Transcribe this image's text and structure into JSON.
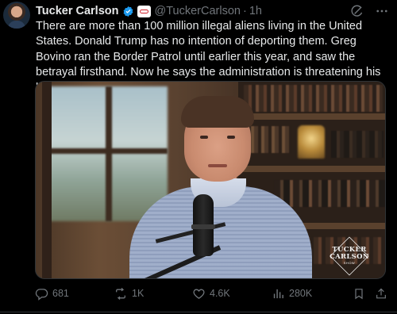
{
  "author": {
    "name": "Tucker Carlson",
    "handle": "@TuckerCarlson",
    "separator": "·",
    "time": "1h"
  },
  "tweet": {
    "text": "There are more than 100 million illegal aliens living in the United States. Donald Trump has no intention of deporting them. Greg Bovino ran the Border Patrol until earlier this year, and saw the betrayal firsthand. Now he says the administration is threatening his life."
  },
  "media": {
    "logo_line1": "TUCKER",
    "logo_line2": "CARLSON",
    "logo_line3": "SHOW"
  },
  "metrics": {
    "replies": "681",
    "reposts": "1K",
    "likes": "4.6K",
    "views": "280K"
  },
  "icons": {
    "grok": "grok-icon",
    "more": "more-icon",
    "verified": "verified-badge-icon",
    "affiliation": "affiliation-badge-icon",
    "reply": "reply-icon",
    "repost": "repost-icon",
    "like": "heart-icon",
    "views": "views-icon",
    "bookmark": "bookmark-icon",
    "share": "share-icon"
  },
  "colors": {
    "background": "#000000",
    "text": "#e7e9ea",
    "muted": "#71767b",
    "verified": "#1d9bf0"
  }
}
